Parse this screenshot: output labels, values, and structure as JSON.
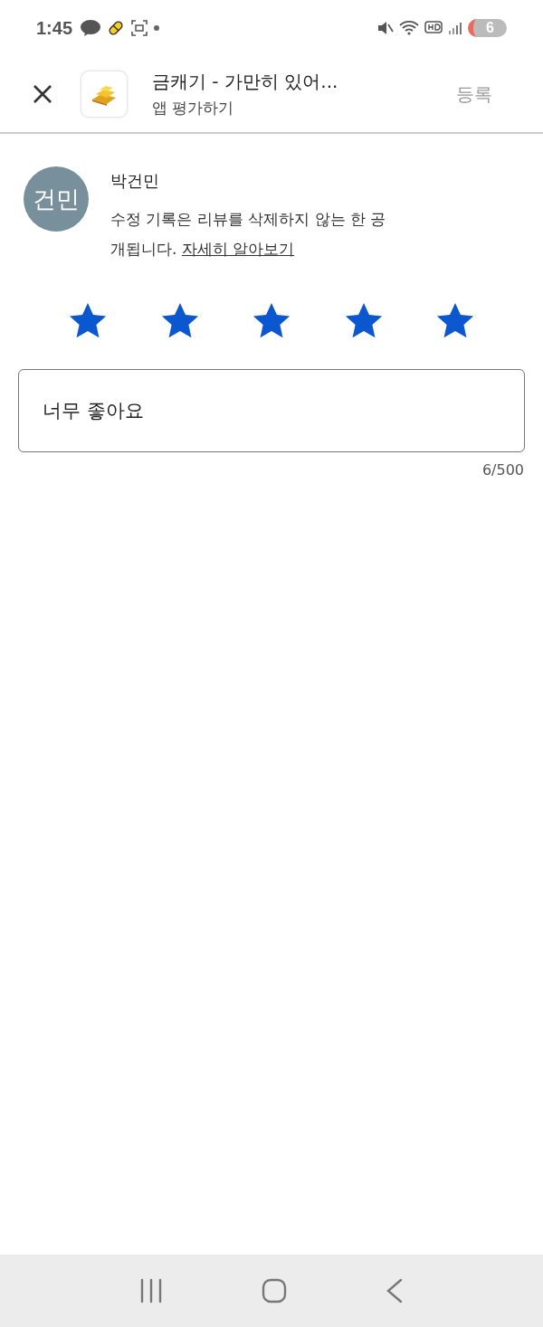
{
  "status_bar": {
    "time": "1:45",
    "notification_count": "6"
  },
  "header": {
    "app_title": "금캐기 - 가만히 있어...",
    "subtitle": "앱 평가하기",
    "submit": {
      "label": "등록",
      "disabled": true
    }
  },
  "reviewer": {
    "initials": "건민",
    "name": "박건민",
    "notice": "수정 기록은 리뷰를 삭제하지 않는 한 공개됩니다.",
    "link": "자세히 알아보기"
  },
  "rating": {
    "stars": 5
  },
  "review": {
    "value": "너무 좋아요",
    "counter": "6/500"
  }
}
